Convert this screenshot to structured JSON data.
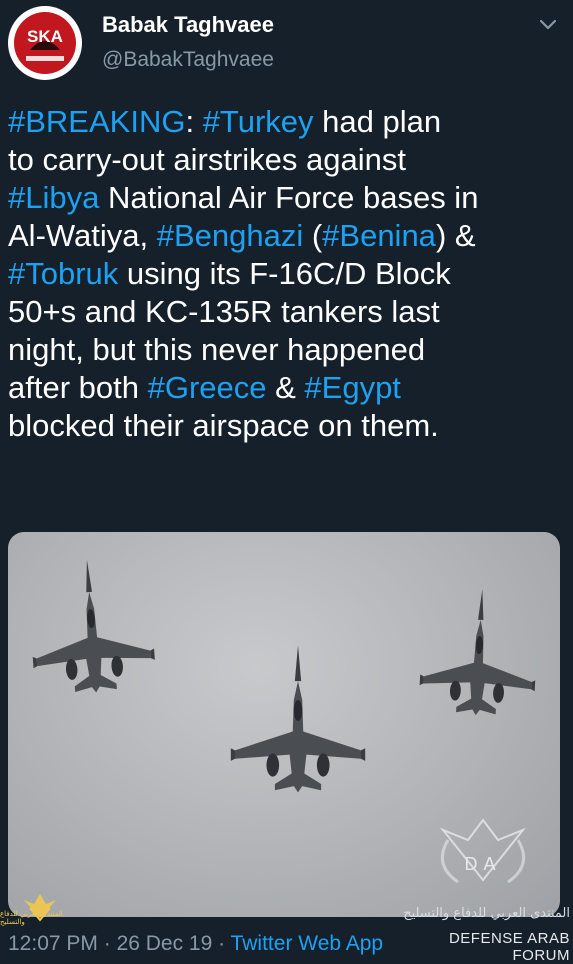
{
  "author": {
    "name": "Babak Taghvaee",
    "handle": "@BabakTaghvaee",
    "avatar_text": "SKA"
  },
  "tweet": {
    "lines": [
      [
        {
          "t": "#BREAKING",
          "tag": true
        },
        {
          "t": ": ",
          "tag": false
        },
        {
          "t": "#Turkey",
          "tag": true
        },
        {
          "t": " had plan",
          "tag": false
        }
      ],
      [
        {
          "t": "to carry-out airstrikes against",
          "tag": false
        }
      ],
      [
        {
          "t": "#Libya",
          "tag": true
        },
        {
          "t": " National Air Force bases in",
          "tag": false
        }
      ],
      [
        {
          "t": "Al-Watiya, ",
          "tag": false
        },
        {
          "t": "#Benghazi",
          "tag": true
        },
        {
          "t": " (",
          "tag": false
        },
        {
          "t": "#Benina",
          "tag": true
        },
        {
          "t": ") &",
          "tag": false
        }
      ],
      [
        {
          "t": "#Tobruk",
          "tag": true
        },
        {
          "t": " using its F-16C/D Block",
          "tag": false
        }
      ],
      [
        {
          "t": "50+s and KC-135R tankers last",
          "tag": false
        }
      ],
      [
        {
          "t": "night, but this never happened",
          "tag": false
        }
      ],
      [
        {
          "t": "after both ",
          "tag": false
        },
        {
          "t": "#Greece",
          "tag": true
        },
        {
          "t": " & ",
          "tag": false
        },
        {
          "t": "#Egypt",
          "tag": true
        }
      ],
      [
        {
          "t": "blocked their airspace on them.",
          "tag": false
        }
      ]
    ]
  },
  "meta": {
    "time": "12:07 PM",
    "sep1": " · ",
    "date": "26 Dec 19",
    "sep2": " · ",
    "source": "Twitter Web App"
  },
  "watermark": {
    "logo_text": "DA",
    "arabic": "المنتدى العربي للدفاع والتسليح",
    "english": "DEFENSE ARAB FORUM",
    "small_text": "المنتدى العربي للدفاع والتسليح"
  },
  "colors": {
    "background": "#15202b",
    "link": "#1da1f2",
    "secondary_text": "#8899a6"
  },
  "icons": {
    "menu_caret": "chevron-down-icon"
  }
}
